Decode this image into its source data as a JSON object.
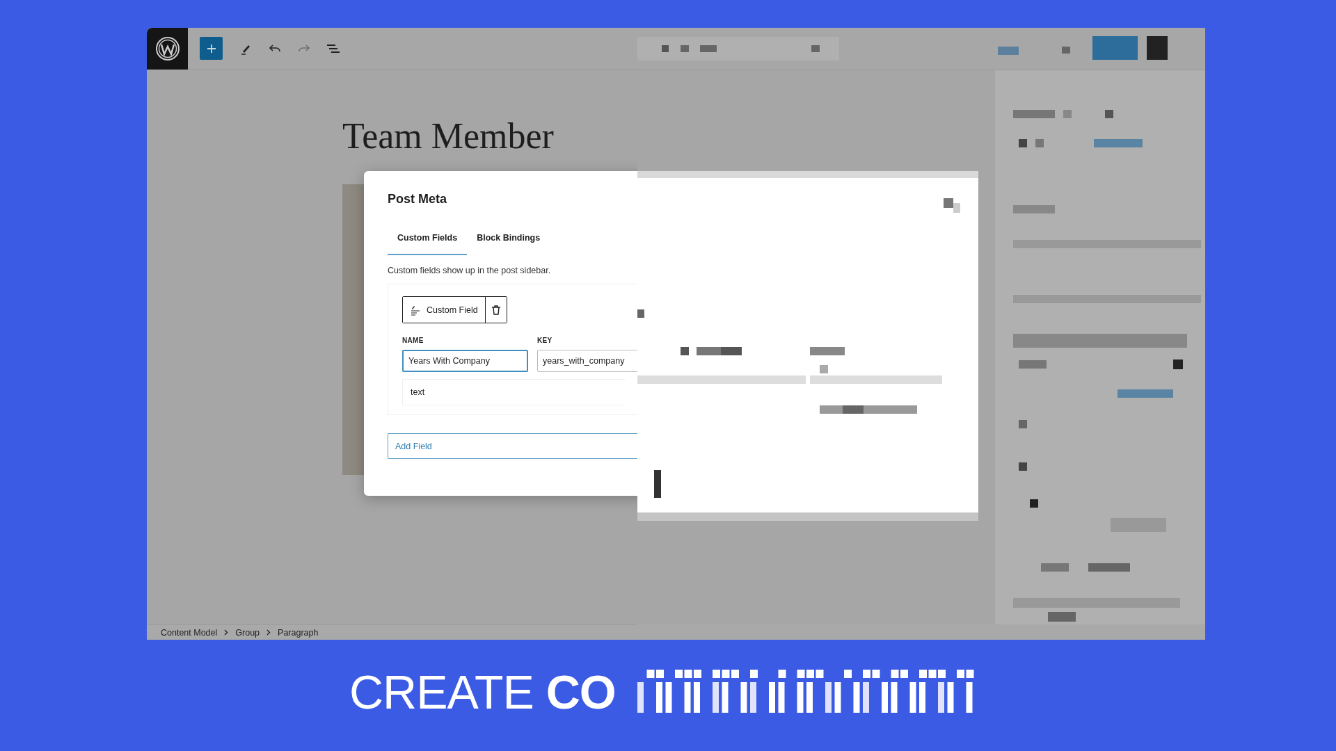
{
  "post_title": "Team Member",
  "modal": {
    "title": "Post Meta",
    "tabs": [
      {
        "label": "Custom Fields",
        "selected": true
      },
      {
        "label": "Block Bindings",
        "selected": false
      }
    ],
    "description": "Custom fields show up in the post sidebar.",
    "field": {
      "type_button": "Custom Field",
      "name_label": "NAME",
      "name_value": "Years With Company",
      "name_focused": true,
      "key_label": "KEY",
      "key_value": "years_with_company",
      "type_value": "text"
    },
    "add_button": "Add Field"
  },
  "breadcrumb": [
    "Content Model",
    "Group",
    "Paragraph"
  ],
  "caption": "CREATE **CO**"
}
